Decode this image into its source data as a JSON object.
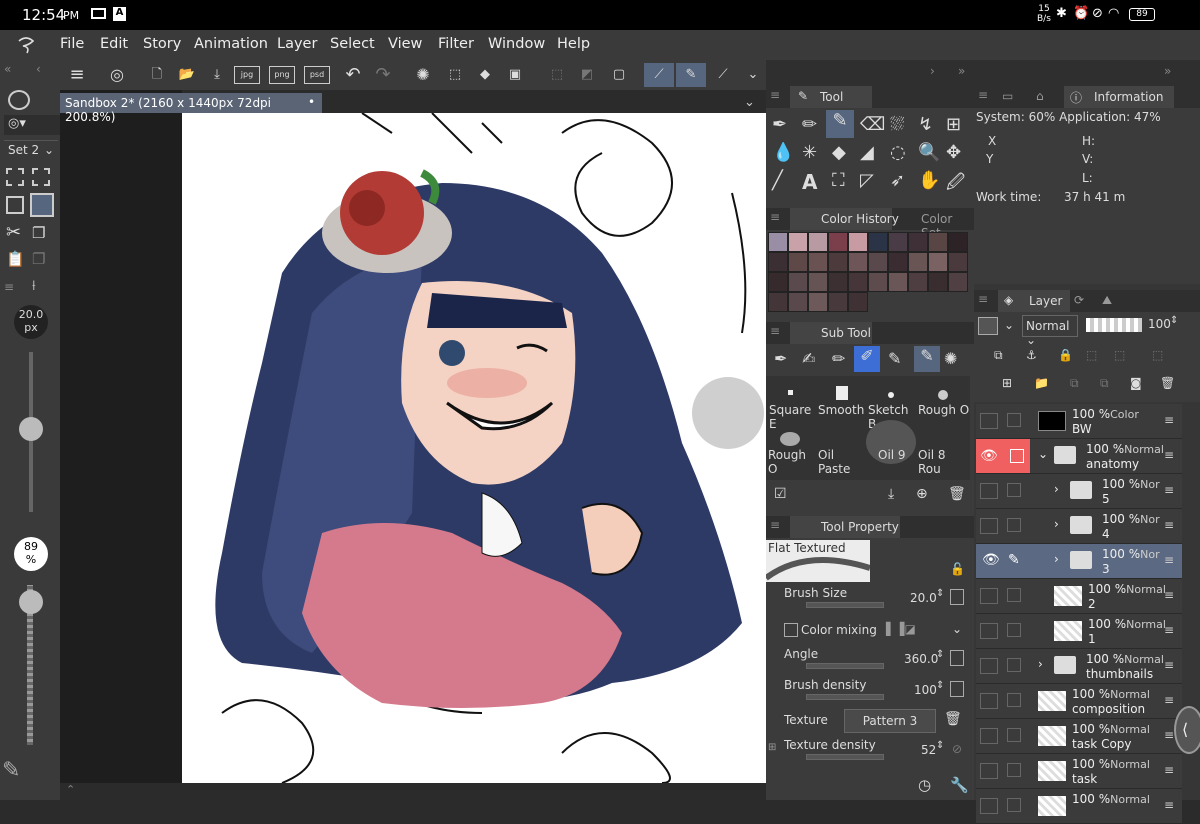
{
  "status": {
    "time": "12:54",
    "ampm": "PM",
    "net_speed": "15",
    "net_unit": "B/s",
    "battery": "89"
  },
  "menu": [
    "File",
    "Edit",
    "Story",
    "Animation",
    "Layer",
    "Select",
    "View",
    "Filter",
    "Window",
    "Help"
  ],
  "left": {
    "set_label": "Set 2",
    "brush_size_value": "20.0",
    "brush_size_unit": "px",
    "opacity_value": "89",
    "opacity_unit": "%"
  },
  "canvas_tab": "Sandbox 2* (2160 x 1440px 72dpi 200.8%)",
  "panels": {
    "tool": "Tool",
    "color_history": "Color History",
    "color_set": "Color Set",
    "sub_tool": "Sub Tool",
    "tool_property": "Tool Property",
    "information": "Information",
    "layer": "Layer"
  },
  "info": {
    "system": "System: 60% Application: 47%",
    "x": "X",
    "y": "Y",
    "h": "H:",
    "v": "V:",
    "l": "L:",
    "work_label": "Work time:",
    "work_value": "37 h 41 m"
  },
  "colors": {
    "history": [
      "#9a8ea6",
      "#c9a1a9",
      "#b89aa3",
      "#7a3f4a",
      "#c79ba1",
      "#2b3346",
      "#4a3c46",
      "#3f2f36",
      "#5a4545",
      "#2d2327",
      "#3b2f33",
      "#5e4848",
      "#6b5252",
      "#4c3a3d",
      "#6d5558",
      "#59484c",
      "#3a2c30",
      "#6a5555",
      "#7a6262",
      "#4a3a3d",
      "#372a2d",
      "#5b4a4d",
      "#665353",
      "#3d3033",
      "#46363a",
      "#5d4b4e",
      "#6a5656",
      "#4e3e41",
      "#3a2d30",
      "#504043",
      "#443538",
      "#5a494c",
      "#6d5959",
      "#483a3c",
      "#3f3134"
    ]
  },
  "subtool": {
    "brushes": [
      "Square E",
      "Smooth",
      "Sketch B",
      "Rough O",
      "Rough O",
      "Oil Paste",
      "Oil 9",
      "Oil 8 Rou"
    ]
  },
  "toolprop": {
    "preset": "Flat Textured",
    "brush_size_label": "Brush Size",
    "brush_size_value": "20.0",
    "color_mixing": "Color mixing",
    "angle_label": "Angle",
    "angle_value": "360.0",
    "density_label": "Brush density",
    "density_value": "100",
    "texture_label": "Texture",
    "texture_value": "Pattern 3",
    "tex_density_label": "Texture density",
    "tex_density_value": "52"
  },
  "layer_panel": {
    "blend": "Normal",
    "opacity": "100"
  },
  "layers": [
    {
      "pct": "100 %",
      "mode": "Color",
      "name": "BW",
      "type": "fill"
    },
    {
      "pct": "100 %",
      "mode": "Normal",
      "name": "anatomy",
      "type": "folder-open"
    },
    {
      "pct": "100 %",
      "mode": "Nor",
      "name": "5",
      "type": "folder"
    },
    {
      "pct": "100 %",
      "mode": "Nor",
      "name": "4",
      "type": "folder"
    },
    {
      "pct": "100 %",
      "mode": "Nor",
      "name": "3",
      "type": "folder"
    },
    {
      "pct": "100 %",
      "mode": "Normal",
      "name": "2",
      "type": "raster"
    },
    {
      "pct": "100 %",
      "mode": "Normal",
      "name": "1",
      "type": "raster"
    },
    {
      "pct": "100 %",
      "mode": "Normal",
      "name": "thumbnails",
      "type": "folder"
    },
    {
      "pct": "100 %",
      "mode": "Normal",
      "name": "composition",
      "type": "raster"
    },
    {
      "pct": "100 %",
      "mode": "Normal",
      "name": "task Copy",
      "type": "raster"
    },
    {
      "pct": "100 %",
      "mode": "Normal",
      "name": "task",
      "type": "raster"
    },
    {
      "pct": "100 %",
      "mode": "Normal",
      "name": "",
      "type": "raster"
    }
  ]
}
